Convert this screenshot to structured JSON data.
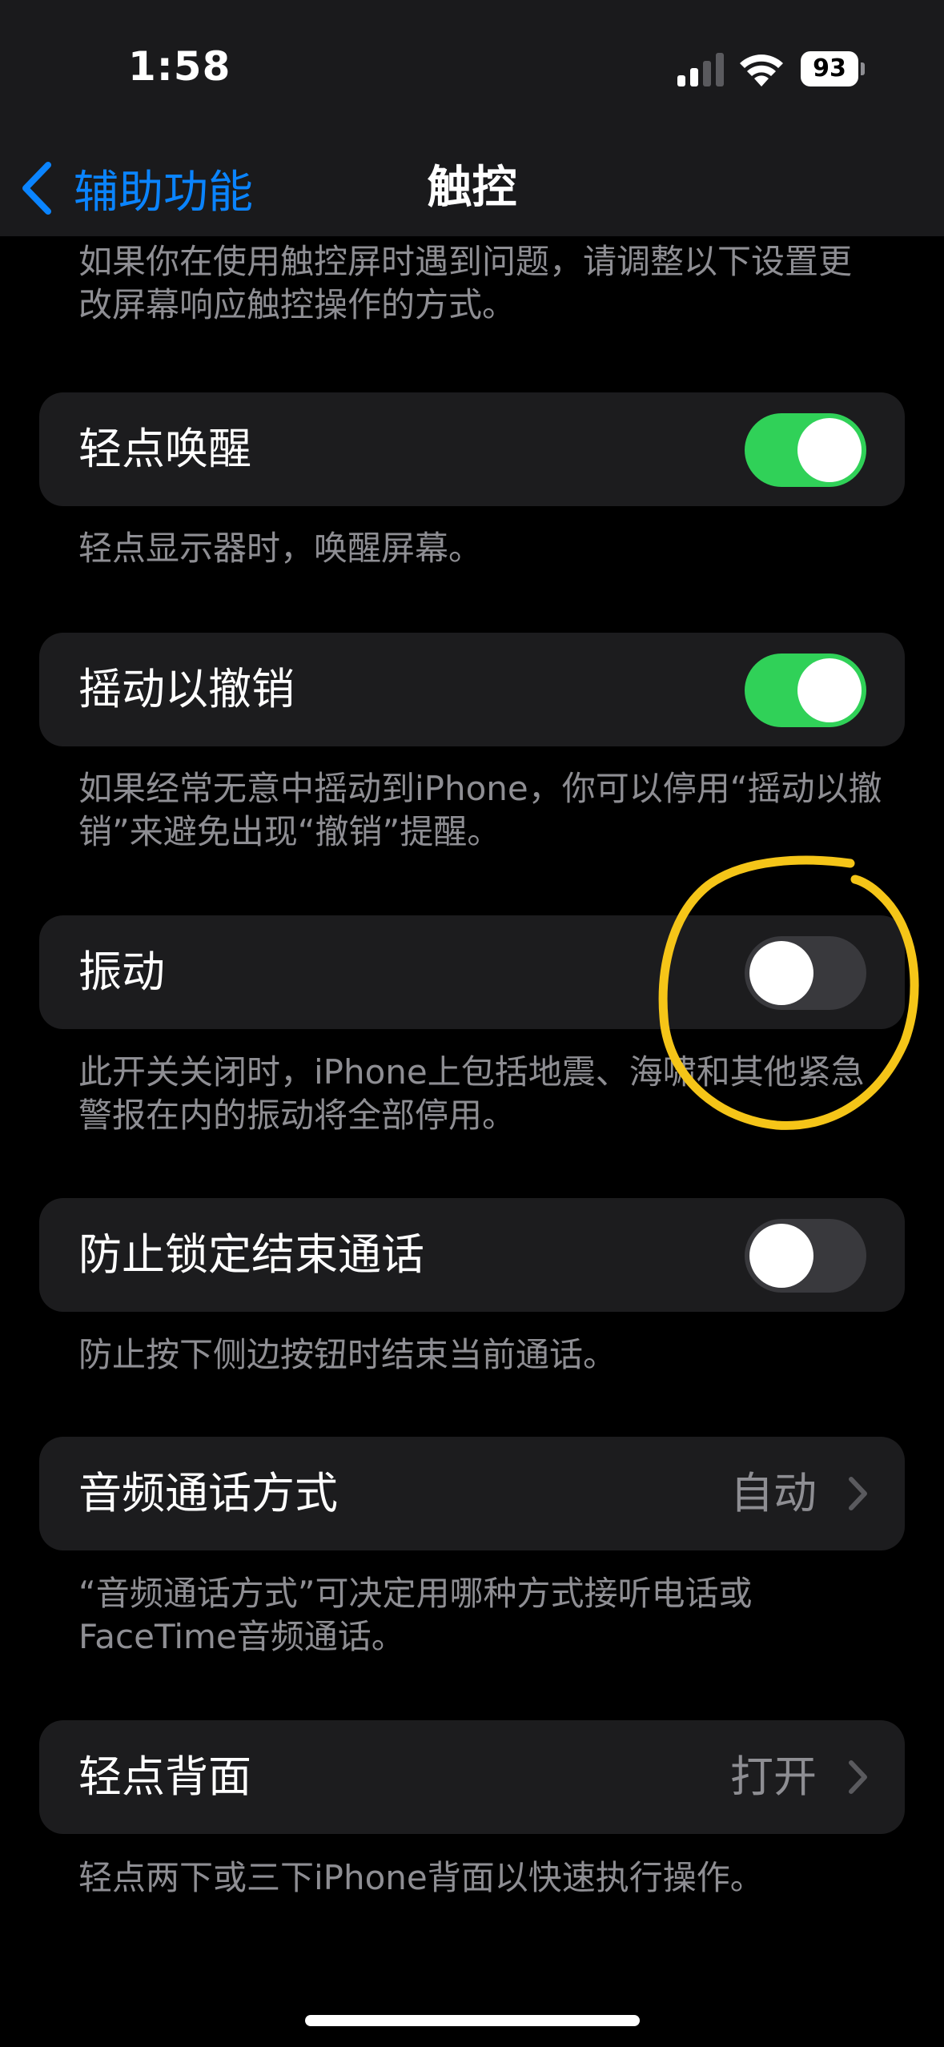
{
  "status_bar": {
    "time": "1:58",
    "battery": "93",
    "signal_icon": "cellular-signal-icon",
    "wifi_icon": "wifi-icon"
  },
  "nav": {
    "back_label": "辅助功能",
    "title": "触控"
  },
  "intro": "如果你在使用触控屏时遇到问题，请调整以下设置更改屏幕响应触控操作的方式。",
  "settings": [
    {
      "label": "轻点唤醒",
      "control": "toggle",
      "on": true,
      "footer": "轻点显示器时，唤醒屏幕。"
    },
    {
      "label": "摇动以撤销",
      "control": "toggle",
      "on": true,
      "footer": "如果经常无意中摇动到iPhone，你可以停用“摇动以撤销”来避免出现“撤销”提醒。"
    },
    {
      "label": "振动",
      "control": "toggle",
      "on": false,
      "footer": "此开关关闭时，iPhone上包括地震、海啸和其他紧急警报在内的振动将全部停用。"
    },
    {
      "label": "防止锁定结束通话",
      "control": "toggle",
      "on": false,
      "footer": "防止按下侧边按钮时结束当前通话。"
    },
    {
      "label": "音频通话方式",
      "control": "disclosure",
      "value": "自动",
      "footer": "“音频通话方式”可决定用哪种方式接听电话或FaceTime音频通话。"
    },
    {
      "label": "轻点背面",
      "control": "disclosure",
      "value": "打开",
      "footer": "轻点两下或三下iPhone背面以快速执行操作。"
    }
  ],
  "colors": {
    "accent": "#0a84ff",
    "toggle_on": "#30d158",
    "toggle_off": "#39393d",
    "annotation": "#f5c518"
  }
}
